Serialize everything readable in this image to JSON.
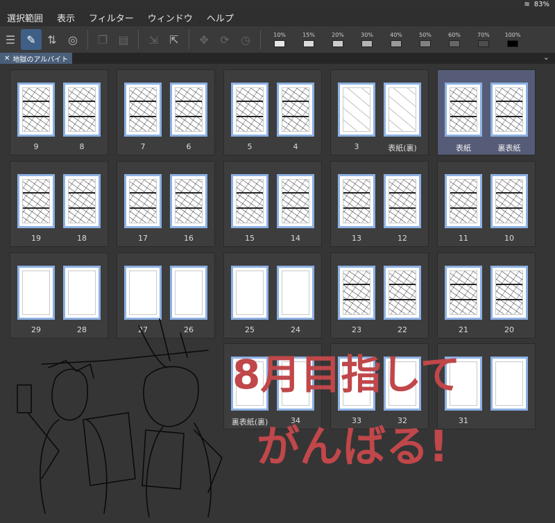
{
  "status": {
    "battery": "83%"
  },
  "menu": [
    "選択範囲",
    "表示",
    "フィルター",
    "ウィンドウ",
    "ヘルプ"
  ],
  "toolbar": {
    "tones": [
      {
        "label": "10%",
        "color": "#e6e6e6"
      },
      {
        "label": "15%",
        "color": "#d9d9d9"
      },
      {
        "label": "20%",
        "color": "#cccccc"
      },
      {
        "label": "30%",
        "color": "#b3b3b3"
      },
      {
        "label": "40%",
        "color": "#999999"
      },
      {
        "label": "50%",
        "color": "#808080"
      },
      {
        "label": "60%",
        "color": "#666666"
      },
      {
        "label": "70%",
        "color": "#4d4d4d"
      },
      {
        "label": "100%",
        "color": "#000000"
      }
    ]
  },
  "tab": {
    "title": "地獄のアルバイト"
  },
  "rows": [
    [
      {
        "left": "9",
        "right": "8",
        "style": "sketch"
      },
      {
        "left": "7",
        "right": "6",
        "style": "sketch"
      },
      {
        "left": "5",
        "right": "4",
        "style": "sketch"
      },
      {
        "left": "3",
        "right": "表紙(裏)",
        "style": "light"
      },
      {
        "left": "表紙",
        "right": "裏表紙",
        "style": "sketch",
        "selected": true
      }
    ],
    [
      {
        "left": "19",
        "right": "18",
        "style": "sketch"
      },
      {
        "left": "17",
        "right": "16",
        "style": "sketch"
      },
      {
        "left": "15",
        "right": "14",
        "style": "sketch"
      },
      {
        "left": "13",
        "right": "12",
        "style": "sketch"
      },
      {
        "left": "11",
        "right": "10",
        "style": "sketch"
      }
    ],
    [
      {
        "left": "29",
        "right": "28",
        "style": "blank"
      },
      {
        "left": "27",
        "right": "26",
        "style": "blank"
      },
      {
        "left": "25",
        "right": "24",
        "style": "blank"
      },
      {
        "left": "23",
        "right": "22",
        "style": "sketch"
      },
      {
        "left": "21",
        "right": "20",
        "style": "sketch"
      }
    ],
    [
      null,
      null,
      {
        "left": "裏表紙(裏)",
        "right": "34",
        "style": "blank"
      },
      {
        "left": "33",
        "right": "32",
        "style": "blank"
      },
      {
        "left": "31",
        "right": "",
        "style": "blank"
      }
    ]
  ],
  "annotation": {
    "line1": "8月目指して",
    "line2": "がんばる!",
    "color": "#c0474a"
  }
}
